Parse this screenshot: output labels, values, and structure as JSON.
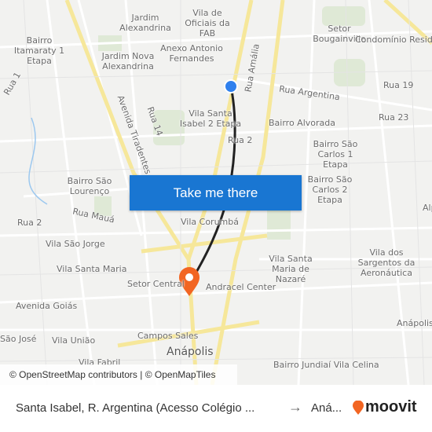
{
  "map": {
    "labels": [
      "Jardim Alexandrina",
      "Vila de Oficiais da FAB",
      "Bairro Itamaraty 1 Etapa",
      "Setor Bougainville",
      "Condomínio Residencial GranTrianon",
      "Anexo Antonio Fernandes",
      "Jardim Nova Alexandrina",
      "Rua 19",
      "Rua Argentina",
      "Rua 23",
      "Rua 1",
      "Vila Santa Isabel 2 Etapa",
      "Bairro Alvorada",
      "Rua 14",
      "Rua 2",
      "Bairro São Carlos 1 Etapa",
      "Avenida Tiradentes",
      "Bairro São Lourenço",
      "Bairro São Carlos 2 Etapa",
      "Rua 2",
      "Rua Mauá",
      "Vila Corumbá",
      "Vila São Jorge",
      "Vila Santa Maria de Nazaré",
      "Vila dos Sargentos da Aeronáutica",
      "Vila Santa Maria",
      "Setor Central",
      "Andracel Center",
      "Avenida Goiás",
      "Anápolis",
      "São José",
      "Vila União",
      "Campos Sales",
      "Anápolis",
      "Vila Fabril",
      "Bairro Jundiaí Vila Celina",
      "Rua Amália",
      "Alp"
    ],
    "origin_color": "#2f80ed",
    "destination_color": "#f26522",
    "route_color": "#222222"
  },
  "cta": {
    "label": "Take me there"
  },
  "attribution": "© OpenStreetMap contributors | © OpenMapTiles",
  "footer": {
    "from": "Santa Isabel, R. Argentina (Acesso Colégio ...",
    "arrow": "→",
    "to": "Aná...",
    "brand": "moovit",
    "brand_color": "#f26522"
  }
}
